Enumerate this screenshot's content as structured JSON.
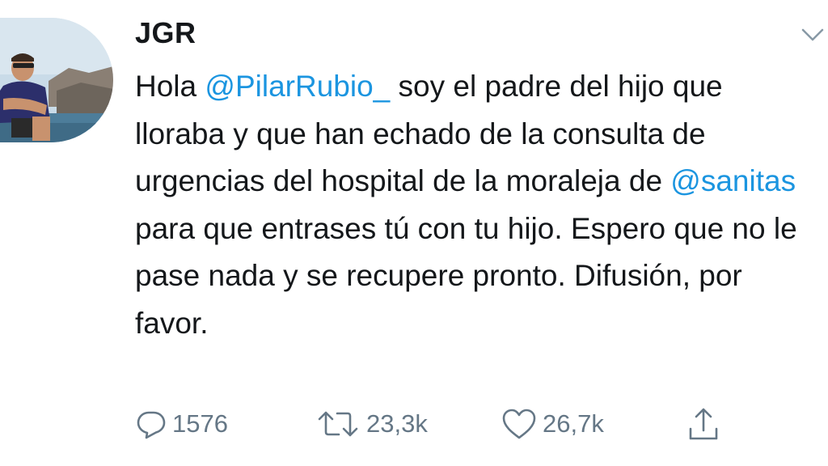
{
  "tweet": {
    "username": "JGR",
    "text_parts": [
      {
        "text": "Hola ",
        "type": "text"
      },
      {
        "text": "@PilarRubio_",
        "type": "mention"
      },
      {
        "text": " soy el padre del hijo que lloraba y que han echado de la consulta de urgencias del hospital de la moraleja de ",
        "type": "text"
      },
      {
        "text": "@sanitas",
        "type": "mention"
      },
      {
        "text": " para que entrases tú con tu hijo. Espero que no le pase nada y se recupere pronto. Difusión, por favor.",
        "type": "text"
      }
    ],
    "stats": {
      "replies": "1576",
      "retweets": "23,3k",
      "likes": "26,7k"
    }
  },
  "icons": {
    "menu": "chevron-down-icon",
    "reply": "speech-bubble-icon",
    "retweet": "retweet-arrows-icon",
    "like": "heart-icon",
    "share": "share-upload-icon"
  },
  "colors": {
    "text": "#14171a",
    "mention": "#1b95e0",
    "secondary": "#657786",
    "background": "#ffffff"
  }
}
